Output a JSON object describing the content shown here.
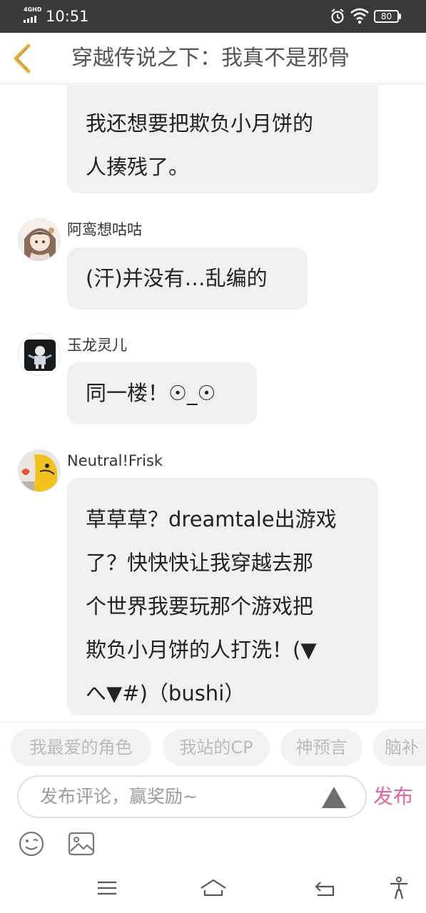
{
  "status_bar": {
    "network": "4GHD",
    "time": "10:51",
    "battery": "80"
  },
  "header": {
    "title": "穿越传说之下：我真不是邪骨"
  },
  "comments": [
    {
      "username": "",
      "text": "我还想要把欺负小月饼的\n人揍残了。"
    },
    {
      "username": "阿鸾想咕咕",
      "text": "(汗)并没有…乱编的"
    },
    {
      "username": "玉龙灵儿",
      "text": "同一楼！☉_☉"
    },
    {
      "username": "Neutral!Frisk",
      "text": "草草草？dreamtale出游戏\n了？快快快让我穿越去那\n个世界我要玩那个游戏把\n欺负小月饼的人打洗！(▼\nへ▼#)（bushi）"
    }
  ],
  "tags": [
    "我最爱的角色",
    "我站的CP",
    "神预言",
    "脑补"
  ],
  "composer": {
    "placeholder": "发布评论，赢奖励~",
    "publish_label": "发布"
  },
  "colors": {
    "status_bar": "#3a3a3a",
    "back_arrow": "#e0b43a",
    "publish": "#e5659c",
    "bubble": "#f0f0f0"
  }
}
